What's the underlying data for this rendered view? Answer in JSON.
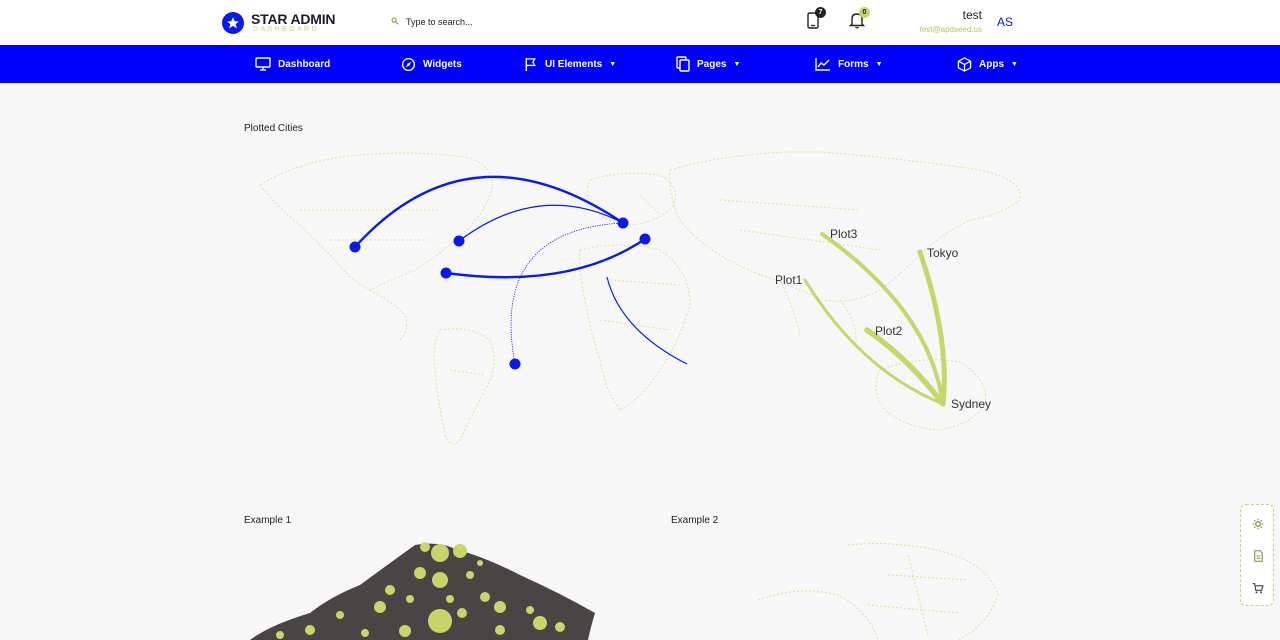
{
  "brand": {
    "name": "STAR ADMIN",
    "subtitle": "DASHBOARD"
  },
  "search": {
    "placeholder": "Type to search..."
  },
  "header": {
    "messages_badge": "7",
    "notifications_badge": "0",
    "user_name": "test",
    "user_email": "test@apdseed.us",
    "avatar_initials": "AS"
  },
  "nav": [
    {
      "label": "Dashboard",
      "icon": "monitor-icon",
      "has_caret": false
    },
    {
      "label": "Widgets",
      "icon": "compass-icon",
      "has_caret": false
    },
    {
      "label": "UI Elements",
      "icon": "flag-icon",
      "has_caret": true
    },
    {
      "label": "Pages",
      "icon": "copy-icon",
      "has_caret": true
    },
    {
      "label": "Forms",
      "icon": "chart-line-icon",
      "has_caret": true
    },
    {
      "label": "Apps",
      "icon": "cube-icon",
      "has_caret": true
    }
  ],
  "cards": {
    "plotted_title": "Plotted Cities",
    "example1_title": "Example 1",
    "example2_title": "Example 2"
  },
  "map_labels": {
    "plot1": "Plot1",
    "plot2": "Plot2",
    "plot3": "Plot3",
    "tokyo": "Tokyo",
    "sydney": "Sydney"
  },
  "colors": {
    "primary": "#0000ff",
    "accent": "#c6d66b",
    "land_dark": "#4a4545"
  },
  "side_panel": [
    "settings-icon",
    "document-icon",
    "cart-icon"
  ]
}
